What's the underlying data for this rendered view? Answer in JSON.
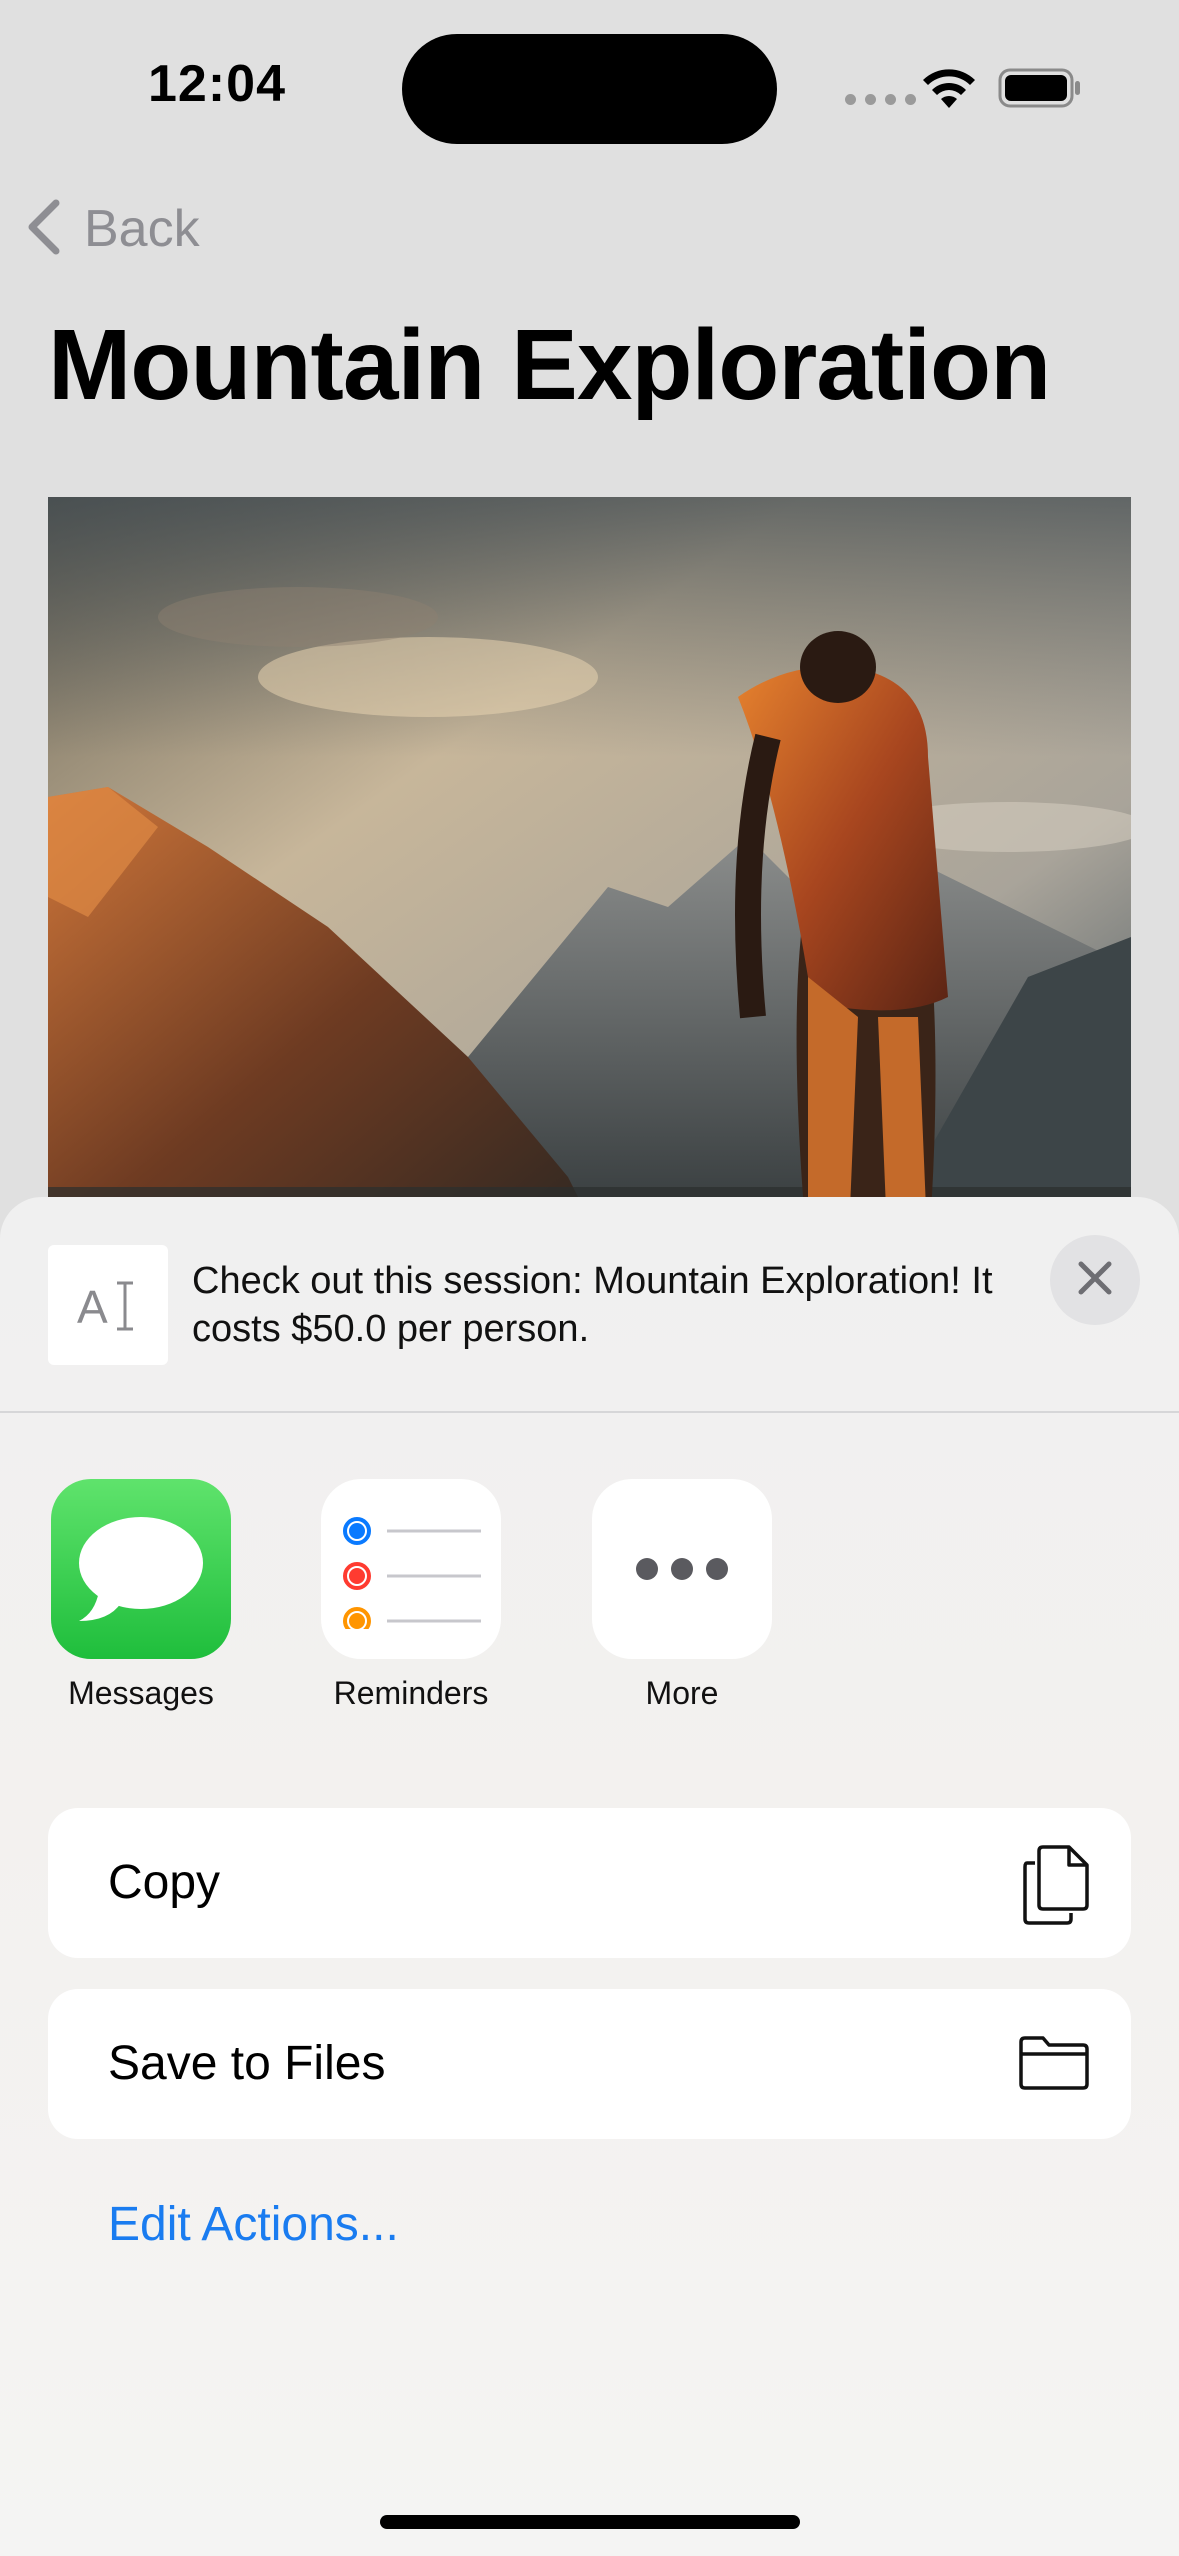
{
  "status_bar": {
    "time": "12:04",
    "icons": [
      "signal-dots-icon",
      "wifi-icon",
      "battery-icon"
    ]
  },
  "nav": {
    "back_label": "Back",
    "back_icon": "chevron-left-icon"
  },
  "page": {
    "title": "Mountain Exploration",
    "hero_image": "hiker-with-orange-backpack-overlooking-mountains-at-sunset"
  },
  "share_sheet": {
    "thumbnail_glyph": "A",
    "preview_text": "Check out this session: Mountain Exploration! It costs $50.0 per person.",
    "close_icon": "close-icon",
    "apps": [
      {
        "label": "Messages",
        "icon": "messages-icon"
      },
      {
        "label": "Reminders",
        "icon": "reminders-icon"
      },
      {
        "label": "More",
        "icon": "more-icon"
      }
    ],
    "actions": [
      {
        "label": "Copy",
        "icon": "copy-icon"
      },
      {
        "label": "Save to Files",
        "icon": "folder-icon"
      }
    ],
    "edit_actions_label": "Edit Actions...",
    "colors": {
      "link": "#1A7CF0",
      "messages_green": "#28C840",
      "reminder_blue": "#0A7AFF",
      "reminder_red": "#FF3B30",
      "reminder_orange": "#FF9500"
    }
  }
}
